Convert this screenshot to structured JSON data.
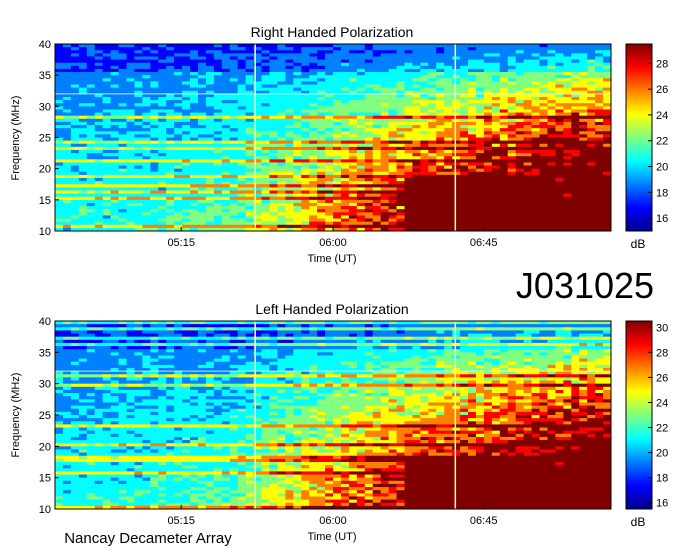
{
  "observation_id": "J031025",
  "instrument": "Nancay Decameter Array",
  "colors": {
    "colormap": [
      "#00008f",
      "#0000ff",
      "#0080ff",
      "#00ffff",
      "#80ff80",
      "#ffff00",
      "#ff8000",
      "#ff0000",
      "#800000"
    ],
    "line": "#ffff99"
  },
  "chart_data": [
    {
      "type": "heatmap",
      "title": "Right Handed Polarization",
      "xlabel": "Time (UT)",
      "ylabel": "Frequency (MHz)",
      "x_ticks": [
        "05:15",
        "06:00",
        "06:45"
      ],
      "y_ticks": [
        10,
        15,
        20,
        25,
        30,
        35,
        40
      ],
      "ylim": [
        10,
        40
      ],
      "colorbar": {
        "label": "dB",
        "ticks": [
          16,
          18,
          20,
          22,
          24,
          26,
          28
        ],
        "range": [
          15,
          29.5
        ]
      }
    },
    {
      "type": "heatmap",
      "title": "Left Handed Polarization",
      "xlabel": "Time (UT)",
      "ylabel": "Frequency (MHz)",
      "x_ticks": [
        "05:15",
        "06:00",
        "06:45"
      ],
      "y_ticks": [
        10,
        15,
        20,
        25,
        30,
        35,
        40
      ],
      "ylim": [
        10,
        40
      ],
      "colorbar": {
        "label": "dB",
        "ticks": [
          16,
          18,
          20,
          22,
          24,
          26,
          28,
          30
        ],
        "range": [
          15.5,
          30.5
        ]
      }
    }
  ]
}
